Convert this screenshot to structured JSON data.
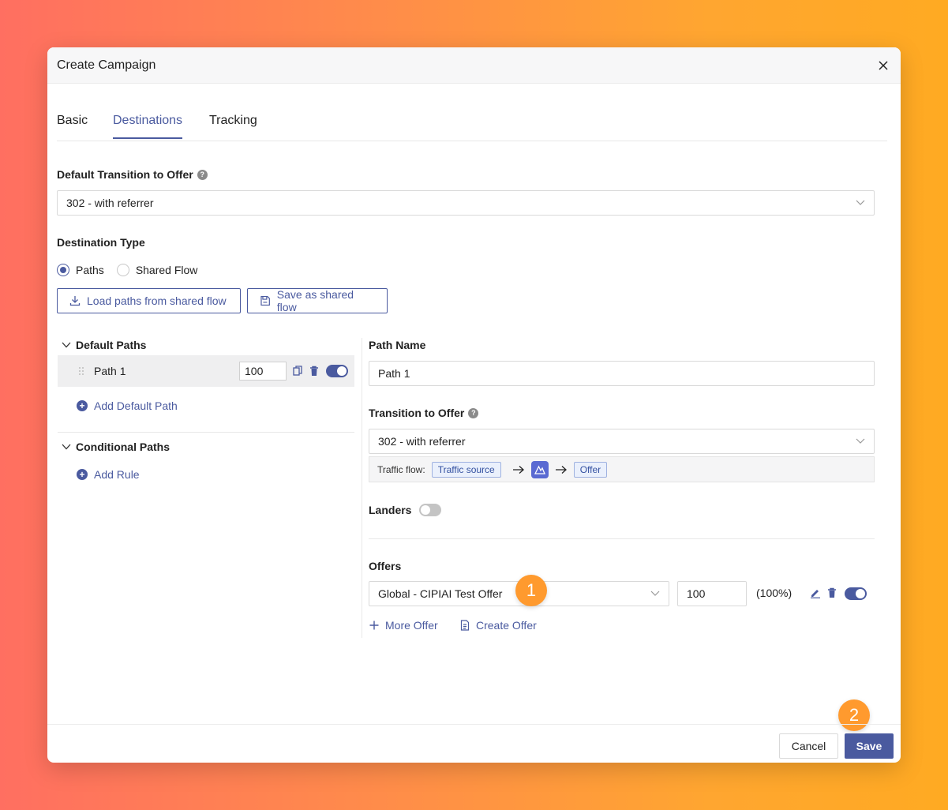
{
  "modal": {
    "title": "Create Campaign"
  },
  "tabs": [
    {
      "label": "Basic"
    },
    {
      "label": "Destinations"
    },
    {
      "label": "Tracking"
    }
  ],
  "active_tab": "Destinations",
  "default_transition": {
    "label": "Default Transition to Offer",
    "value": "302 - with referrer"
  },
  "destination_type": {
    "label": "Destination Type",
    "options": [
      "Paths",
      "Shared Flow"
    ],
    "selected": "Paths"
  },
  "buttons": {
    "load_shared": "Load paths from shared flow",
    "save_shared": "Save as shared flow"
  },
  "default_paths": {
    "title": "Default Paths",
    "items": [
      {
        "name": "Path 1",
        "weight": "100",
        "enabled": true
      }
    ],
    "add_label": "Add Default Path"
  },
  "conditional_paths": {
    "title": "Conditional Paths",
    "add_label": "Add Rule"
  },
  "path_detail": {
    "name_label": "Path Name",
    "name_value": "Path 1",
    "transition_label": "Transition to Offer",
    "transition_value": "302 - with referrer",
    "traffic_flow_label": "Traffic flow:",
    "traffic_source": "Traffic source",
    "offer_chip": "Offer",
    "landers_label": "Landers",
    "landers_enabled": false,
    "offers_label": "Offers",
    "offers": [
      {
        "name": "Global - CIPIAI Test Offer",
        "weight": "100",
        "percent": "(100%)",
        "enabled": true
      }
    ],
    "more_offer": "More Offer",
    "create_offer": "Create Offer"
  },
  "badges": [
    "1",
    "2"
  ],
  "footer": {
    "cancel": "Cancel",
    "save": "Save"
  },
  "colors": {
    "primary": "#4a5a9f",
    "badge": "#ff9a2e"
  }
}
